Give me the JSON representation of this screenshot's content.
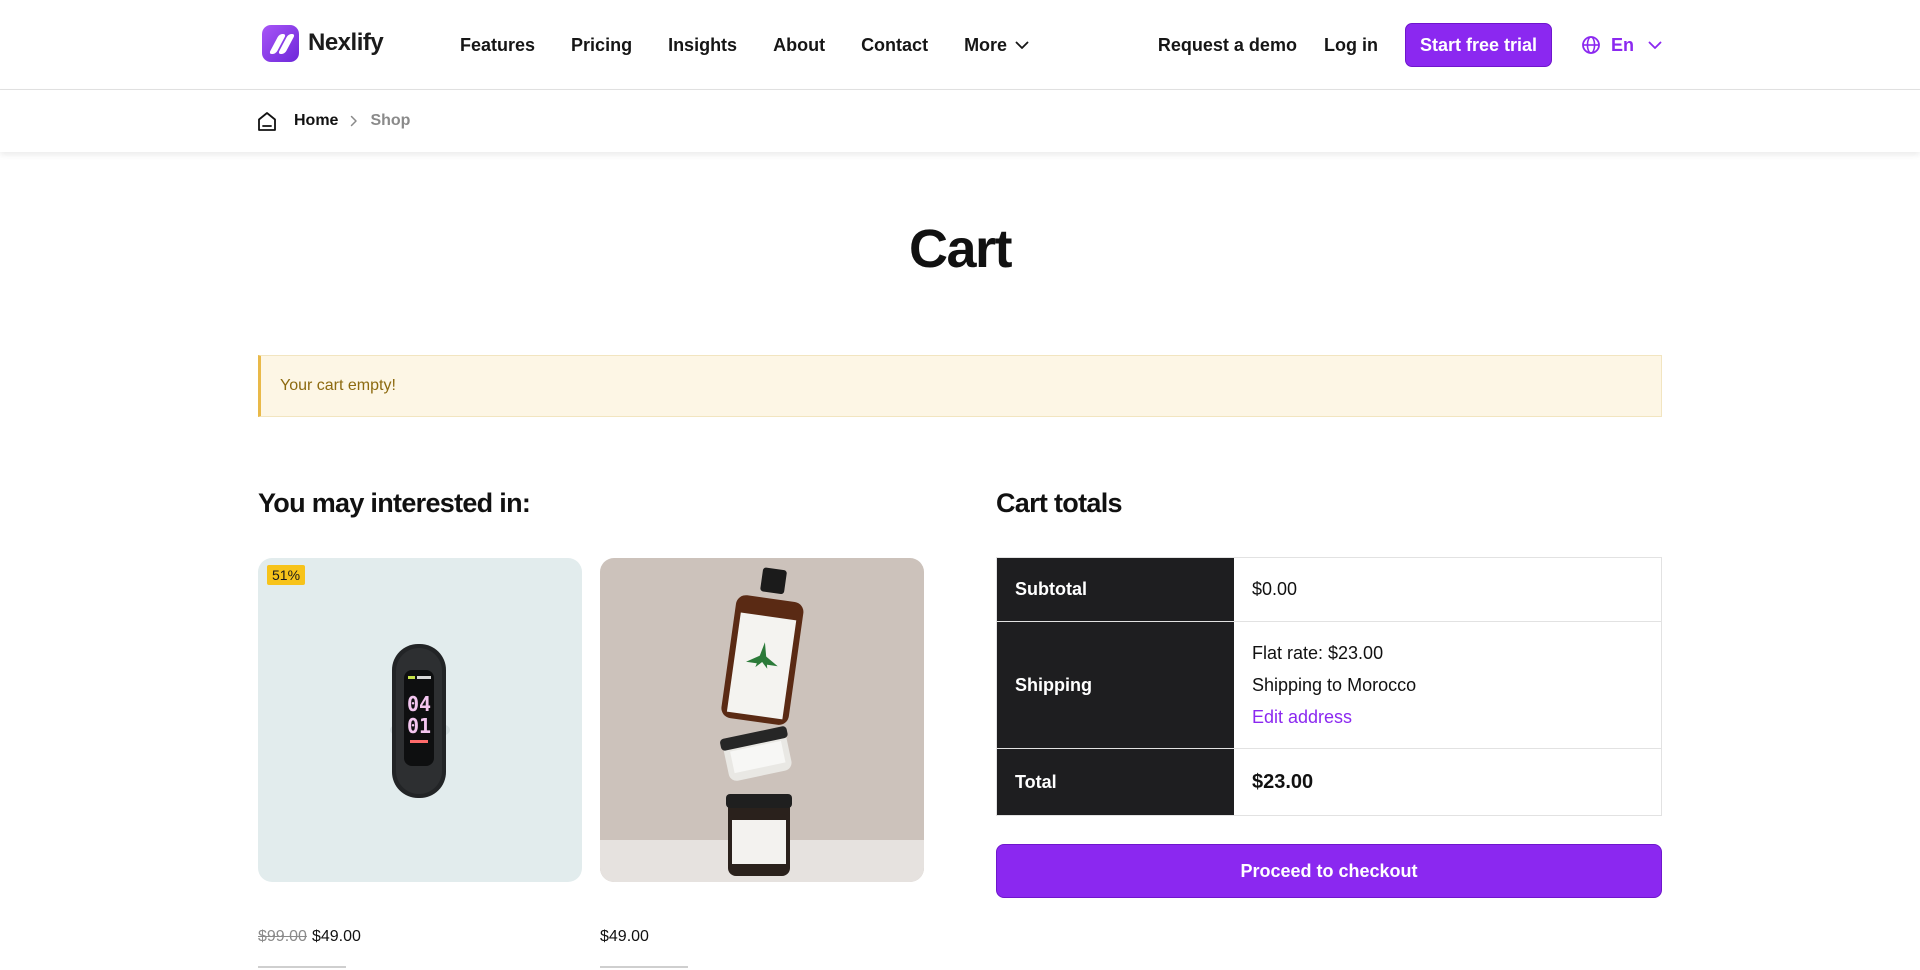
{
  "brand": {
    "name": "Nexlify",
    "accent": "#8b28f0"
  },
  "nav": {
    "items": [
      {
        "label": "Features"
      },
      {
        "label": "Pricing"
      },
      {
        "label": "Insights"
      },
      {
        "label": "About"
      },
      {
        "label": "Contact"
      },
      {
        "label": "More",
        "icon": "chevron-down-icon"
      }
    ]
  },
  "header_actions": {
    "demo_label": "Request a demo",
    "login_label": "Log in",
    "trial_label": "Start free trial",
    "language": "En"
  },
  "breadcrumb": {
    "home": "Home",
    "current": "Shop"
  },
  "page": {
    "title": "Cart"
  },
  "notice": {
    "text": "Your cart empty!",
    "color": "#e9b949"
  },
  "recommendations": {
    "heading": "You may interested in:",
    "products": [
      {
        "badge": "51%",
        "old_price": "$99.00",
        "price": "$49.00",
        "image": "fitness-band"
      },
      {
        "price": "$49.00",
        "image": "stacked-jars"
      }
    ]
  },
  "cart_totals": {
    "heading": "Cart totals",
    "subtotal_label": "Subtotal",
    "subtotal_value": "$0.00",
    "shipping_label": "Shipping",
    "shipping_rate": "Flat rate: $23.00",
    "shipping_destination": "Shipping to Morocco",
    "edit_address": "Edit address",
    "total_label": "Total",
    "total_value": "$23.00",
    "checkout_label": "Proceed to checkout"
  }
}
